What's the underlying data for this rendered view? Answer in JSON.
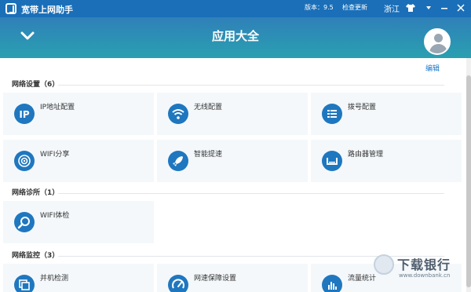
{
  "window": {
    "app_title": "宽带上网助手",
    "version_text": "版本：9.5",
    "update_link": "检查更新",
    "province": "浙江",
    "controls": [
      "shirt-icon",
      "dropdown-icon",
      "minimize-icon",
      "close-icon"
    ]
  },
  "header": {
    "title": "应用大全",
    "edit_label": "编辑"
  },
  "sections": [
    {
      "title": "网络设置（6）",
      "items": [
        {
          "label": "IP地址配置",
          "icon": "ip-icon"
        },
        {
          "label": "无线配置",
          "icon": "wifi-icon"
        },
        {
          "label": "拨号配置",
          "icon": "dial-list-icon"
        },
        {
          "label": "WIFI分享",
          "icon": "wifi-share-icon"
        },
        {
          "label": "智能提速",
          "icon": "rocket-icon"
        },
        {
          "label": "路由器管理",
          "icon": "router-icon"
        }
      ]
    },
    {
      "title": "网络诊所（1）",
      "items": [
        {
          "label": "WIFI体检",
          "icon": "wifi-check-icon"
        }
      ]
    },
    {
      "title": "网络监控（3）",
      "items": [
        {
          "label": "并机检测",
          "icon": "multi-device-icon"
        },
        {
          "label": "网速保障设置",
          "icon": "speed-gauge-icon"
        },
        {
          "label": "流量统计",
          "icon": "bar-chart-icon"
        }
      ]
    }
  ],
  "watermark": {
    "name": "下载银行",
    "url": "www.downbank.cn"
  }
}
